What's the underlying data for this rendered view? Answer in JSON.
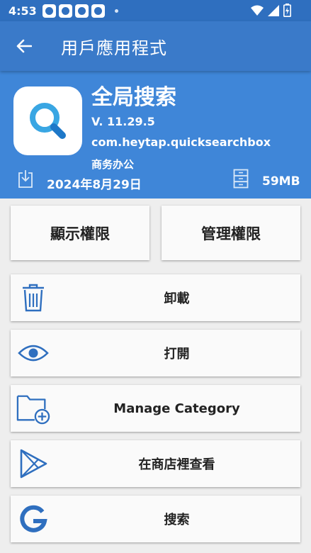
{
  "status_bar": {
    "time": "4:53"
  },
  "app_bar": {
    "title": "用戶應用程式"
  },
  "app": {
    "name": "全局搜索",
    "version": "V. 11.29.5",
    "package": "com.heytap.quicksearchbox",
    "category": "商务办公",
    "install_date": "2024年8月29日",
    "size": "59MB"
  },
  "permissions": {
    "show_label": "顯示權限",
    "manage_label": "管理權限"
  },
  "actions": {
    "uninstall": "卸載",
    "open": "打開",
    "manage_category": "Manage Category",
    "view_in_store": "在商店裡查看",
    "search": "搜索"
  },
  "colors": {
    "status_bar": "#2f6fbf",
    "app_bar": "#3a7ac9",
    "header": "#3f86d8",
    "accent": "#2f6fbf",
    "icon_search_ring": "#39a6e3"
  }
}
